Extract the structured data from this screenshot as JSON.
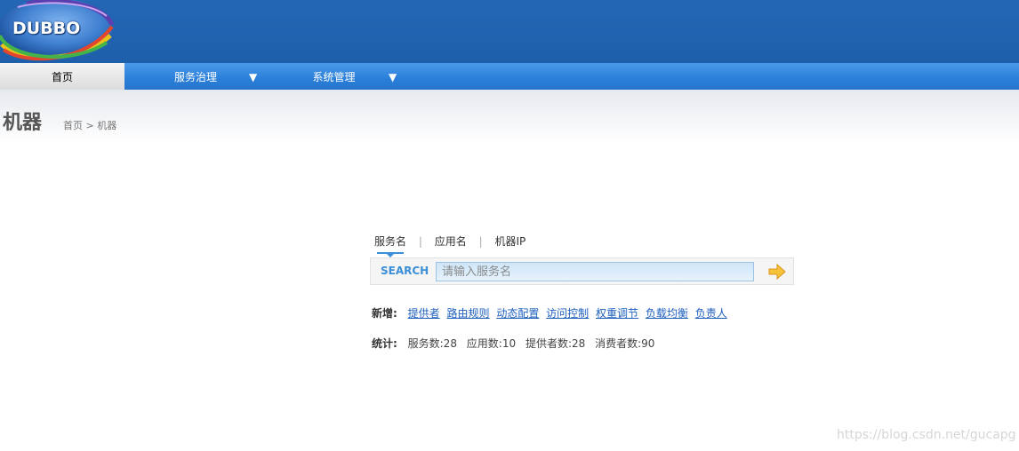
{
  "header": {
    "logo_text": "DUBBO"
  },
  "nav": {
    "items": [
      {
        "label": "首页",
        "active": true
      },
      {
        "label": "服务治理",
        "dropdown_icon": "triangle-down-icon"
      },
      {
        "label": "系统管理",
        "dropdown_icon": "triangle-down-icon"
      }
    ]
  },
  "page": {
    "title": "机器",
    "breadcrumb": {
      "home": "首页",
      "separator": ">",
      "current": "机器"
    }
  },
  "search": {
    "tabs": [
      {
        "label": "服务名",
        "active": true
      },
      {
        "label": "应用名"
      },
      {
        "label": "机器IP"
      }
    ],
    "tab_separator": "|",
    "label": "SEARCH",
    "placeholder": "请输入服务名",
    "go_icon": "arrow-right-icon"
  },
  "add": {
    "label": "新增:",
    "links": [
      "提供者",
      "路由规则",
      "动态配置",
      "访问控制",
      "权重调节",
      "负载均衡",
      "负责人"
    ]
  },
  "stats": {
    "label": "统计:",
    "items": [
      "服务数:28",
      "应用数:10",
      "提供者数:28",
      "消费者数:90"
    ]
  },
  "watermark": "https://blog.csdn.net/gucapg",
  "colors": {
    "header_bg": "#1e5fab",
    "nav_bg": "#2b7fd9",
    "accent": "#3a8fd8",
    "link": "#1d5fbd"
  }
}
